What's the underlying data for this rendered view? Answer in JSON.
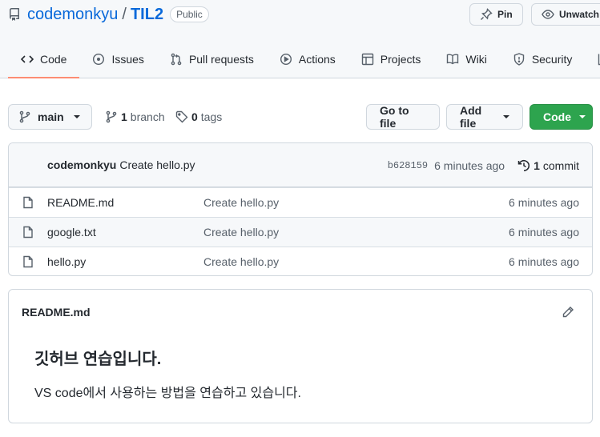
{
  "repo": {
    "owner": "codemonkyu",
    "separator": "/",
    "name": "TIL2",
    "visibility": "Public"
  },
  "actions": {
    "pin_label": "Pin",
    "watch_label": "Unwatch"
  },
  "tabs": [
    {
      "label": "Code",
      "icon": "code-icon",
      "active": true
    },
    {
      "label": "Issues",
      "icon": "issue-icon"
    },
    {
      "label": "Pull requests",
      "icon": "pull-request-icon"
    },
    {
      "label": "Actions",
      "icon": "play-icon"
    },
    {
      "label": "Projects",
      "icon": "table-icon"
    },
    {
      "label": "Wiki",
      "icon": "book-icon"
    },
    {
      "label": "Security",
      "icon": "shield-icon"
    }
  ],
  "branch": {
    "current": "main",
    "branch_count": "1",
    "branch_label": "branch",
    "tag_count": "0",
    "tag_label": "tags"
  },
  "buttons": {
    "goto_file": "Go to file",
    "add_file": "Add file",
    "code": "Code"
  },
  "latest_commit": {
    "author": "codemonkyu",
    "message": "Create hello.py",
    "sha": "b628159",
    "time": "6 minutes ago",
    "count": "1",
    "count_label": "commit"
  },
  "files": [
    {
      "name": "README.md",
      "message": "Create hello.py",
      "time": "6 minutes ago"
    },
    {
      "name": "google.txt",
      "message": "Create hello.py",
      "time": "6 minutes ago"
    },
    {
      "name": "hello.py",
      "message": "Create hello.py",
      "time": "6 minutes ago"
    }
  ],
  "readme": {
    "filename": "README.md",
    "heading": "깃허브 연습입니다.",
    "body": "VS code에서 사용하는 방법을 연습하고 있습니다."
  },
  "colors": {
    "accent": "#0969da",
    "primary_button": "#2da44e",
    "tab_underline": "#fd8c73"
  }
}
